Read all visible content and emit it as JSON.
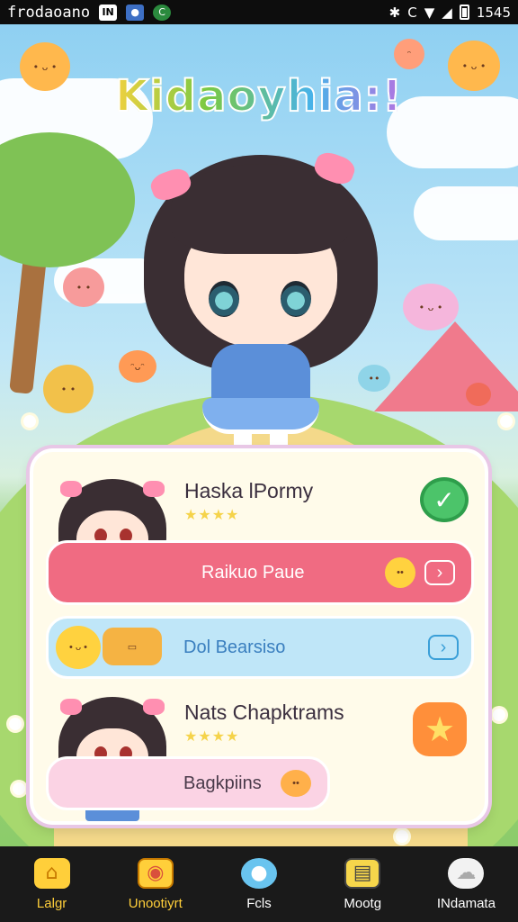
{
  "status_bar": {
    "carrier": "frodaoano",
    "time": "1545"
  },
  "app": {
    "title": "Kidaoyhia:!"
  },
  "cards": [
    {
      "title": "Haska lPormy",
      "stars": "★★★★",
      "button_label": "Raikuo Paue",
      "badge_icon": "check-icon"
    },
    {
      "title": "",
      "button_label": "Dol Bearsiso",
      "icon": "basket-icon"
    },
    {
      "title": "Nats Chapktrams",
      "stars": "★★★★",
      "button_label": "Bagkpiins",
      "badge_icon": "star-icon"
    }
  ],
  "bottom_nav": [
    {
      "label": "Lalgr",
      "icon": "home-icon"
    },
    {
      "label": "Unootiyrt",
      "icon": "photo-icon"
    },
    {
      "label": "Fcls",
      "icon": "chat-bubble-icon"
    },
    {
      "label": "Mootg",
      "icon": "book-icon"
    },
    {
      "label": "INdamata",
      "icon": "cloud-icon"
    }
  ],
  "colors": {
    "nav_active": "#ffcf3a",
    "button_pink": "#f06b82",
    "button_blue": "#bfe6f8",
    "button_light_pink": "#fbd3e4"
  }
}
